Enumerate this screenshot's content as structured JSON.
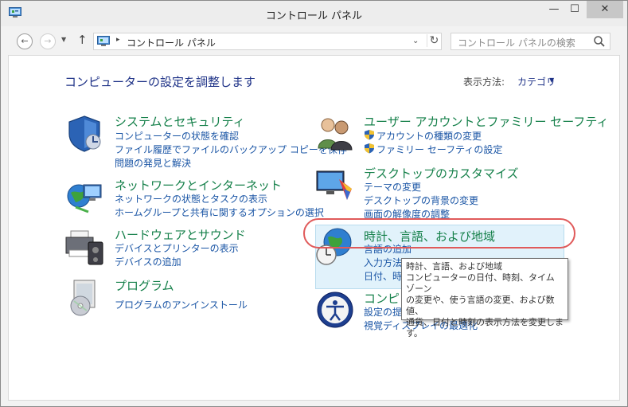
{
  "window": {
    "title": "コントロール パネル",
    "min_symbol": "—",
    "max_symbol": "☐",
    "close_symbol": "✕"
  },
  "nav": {
    "back_symbol": "←",
    "forward_symbol": "→",
    "recent_symbol": "▼",
    "up_symbol": "↑",
    "address_separator": "▸",
    "address_text": "コントロール パネル",
    "address_dropdown": "⌄",
    "refresh_symbol": "↻",
    "search_placeholder": "コントロール パネルの検索"
  },
  "header": {
    "title": "コンピューターの設定を調整します",
    "view_label": "表示方法:",
    "view_value": "カテゴリ",
    "view_arrow": "▼"
  },
  "categories": {
    "system": {
      "title": "システムとセキュリティ",
      "links": [
        "コンピューターの状態を確認",
        "ファイル履歴でファイルのバックアップ コピーを保存",
        "問題の発見と解決"
      ]
    },
    "network": {
      "title": "ネットワークとインターネット",
      "links": [
        "ネットワークの状態とタスクの表示",
        "ホームグループと共有に関するオプションの選択"
      ]
    },
    "hardware": {
      "title": "ハードウェアとサウンド",
      "links": [
        "デバイスとプリンターの表示",
        "デバイスの追加"
      ]
    },
    "programs": {
      "title": "プログラム",
      "links": [
        "プログラムのアンインストール"
      ]
    },
    "users": {
      "title": "ユーザー アカウントとファミリー セーフティ",
      "links": [
        "アカウントの種類の変更",
        "ファミリー セーフティの設定"
      ]
    },
    "appearance": {
      "title": "デスクトップのカスタマイズ",
      "links": [
        "テーマの変更",
        "デスクトップの背景の変更",
        "画面の解像度の調整"
      ]
    },
    "clock": {
      "title": "時計、言語、および地域",
      "links": [
        "言語の追加",
        "入力方法",
        "日付、時"
      ]
    },
    "ease": {
      "title": "コンピュ",
      "links": [
        "設定の提",
        "視覚ディスプレイの最適化"
      ]
    }
  },
  "tooltip": {
    "lines": [
      "時計、言語、および地域",
      "コンピューターの日付、時刻、タイム ゾーン",
      "の変更や、使う言語の変更、および数値、",
      "通貨、日付と時刻の表示方法を変更しま",
      "す。"
    ]
  },
  "colors": {
    "title_blue": "#1e3287",
    "category_green": "#15804a",
    "link_blue": "#1a55a5",
    "highlight": "#e1f2fb",
    "annotation_red": "#e05a5a"
  }
}
